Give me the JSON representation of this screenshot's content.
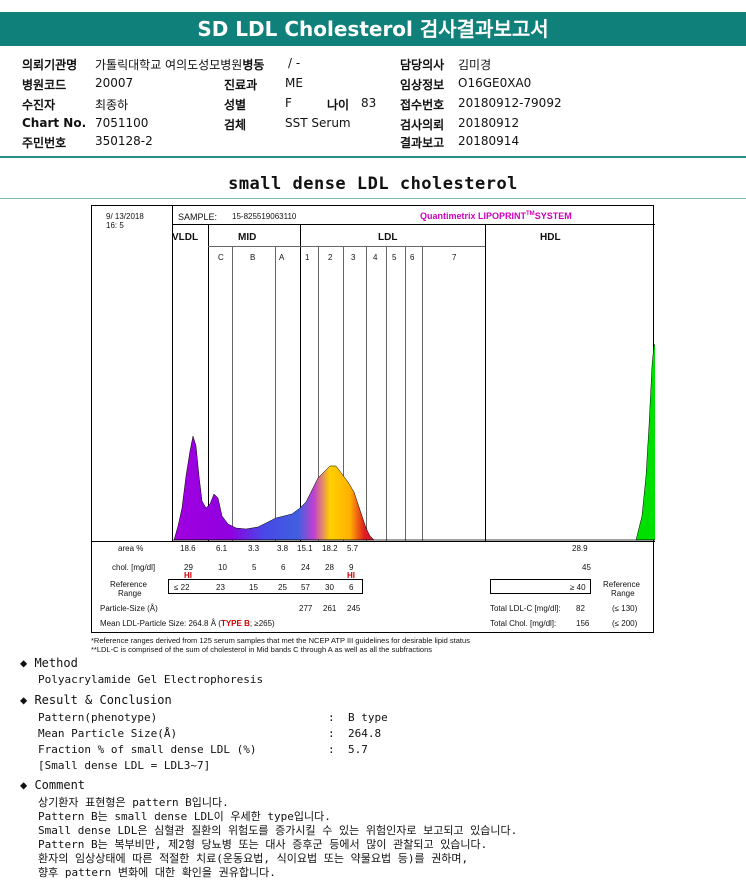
{
  "title": "SD LDL Cholesterol 검사결과보고서",
  "info": {
    "institution_label": "의뢰기관명",
    "institution_value": "가톨릭대학교 여의도성모병원",
    "ward_label": "병동",
    "ward_value": "/ -",
    "doctor_label": "담당의사",
    "doctor_value": "김미경",
    "hospital_code_label": "병원코드",
    "hospital_code_value": "20007",
    "department_label": "진료과",
    "department_value": "ME",
    "clinical_info_label": "임상정보",
    "clinical_info_value": "O16GE0XA0",
    "patient_label": "수진자",
    "patient_value": "최종하",
    "sex_label": "성별",
    "sex_value": "F",
    "age_label": "나이",
    "age_value": "83",
    "receipt_no_label": "접수번호",
    "receipt_no_value": "20180912-79092",
    "chart_no_label": "Chart No.",
    "chart_no_value": "7051100",
    "specimen_label": "검체",
    "specimen_value": "SST Serum",
    "request_date_label": "검사의뢰",
    "request_date_value": "20180912",
    "resident_no_label": "주민번호",
    "resident_no_value": "350128-2",
    "report_date_label": "결과보고",
    "report_date_value": "20180914"
  },
  "section_title": "small dense LDL cholesterol",
  "report": {
    "date": "9/ 13/2018",
    "time": "16: 5",
    "sample_label": "SAMPLE:",
    "sample_value": "15-825519063110",
    "system_name": "Quantimetrix LIPOPRINT",
    "system_tm": "TM",
    "system_suffix": "SYSTEM",
    "group_vldl": "VLDL",
    "group_mid": "MID",
    "group_ldl": "LDL",
    "group_hdl": "HDL",
    "bands": [
      "C",
      "B",
      "A",
      "1",
      "2",
      "3",
      "4",
      "5",
      "6",
      "7"
    ],
    "area_label": "area %",
    "area_values": [
      "18.6",
      "6.1",
      "3.3",
      "3.8",
      "15.1",
      "18.2",
      "5.7"
    ],
    "area_hdl": "28.9",
    "chol_label": "chol. [mg/dl]",
    "chol_values": [
      "29",
      "10",
      "5",
      "6",
      "24",
      "28",
      "9"
    ],
    "chol_hdl": "45",
    "hi_flag": "HI",
    "ref_label_1": "Reference",
    "ref_label_2": "Range",
    "ref_values": [
      "≤ 22",
      "23",
      "15",
      "25",
      "57",
      "30",
      "6"
    ],
    "ref_hdl": "≥ 40",
    "particle_label": "Particle-Size (Å)",
    "particle_values": [
      "277",
      "261",
      "245"
    ],
    "mean_size_text": "Mean LDL-Particle Size:    264.8 Å  (",
    "type_b": "TYPE B",
    "mean_size_suffix": "; ≥265)",
    "total_ldl_label": "Total LDL-C [mg/dl]:",
    "total_ldl_value": "82",
    "total_ldl_ref": "(≤ 130)",
    "total_chol_label": "Total Chol. [mg/dl]:",
    "total_chol_value": "156",
    "total_chol_ref": "(≤ 200)"
  },
  "footnotes": [
    "*Reference ranges derived from 125 serum samples that met the NCEP ATP III guidelines for desirable lipid status",
    "**LDL-C is comprised of the sum of cholesterol in Mid bands C through A as well as all the subfractions"
  ],
  "method_heading": "◆ Method",
  "method_text": "Polyacrylamide Gel Electrophoresis",
  "result_heading": "◆ Result & Conclusion",
  "results": [
    {
      "label": "Pattern(phenotype)",
      "colon": ":",
      "value": "B type"
    },
    {
      "label": "Mean Particle Size(Å)",
      "colon": ":",
      "value": "264.8"
    },
    {
      "label": "Fraction % of small dense LDL (%)",
      "colon": ":",
      "value": "5.7"
    }
  ],
  "small_dense_note": "[Small dense LDL = LDL3~7]",
  "comment_heading": "◆ Comment",
  "comments": [
    "상기환자 표현형은 pattern B입니다.",
    "Pattern B는 small dense LDL이 우세한 type입니다.",
    "Small dense LDL은 심혈관 질환의 위험도를 증가시킬 수 있는 위험인자로 보고되고 있습니다.",
    "Pattern B는 복부비만, 제2형 당뇨병 또는 대사 증후군 등에서 많이 관찰되고 있습니다.",
    "환자의 임상상태에 따른 적절한 치료(운동요법, 식이요법 또는 약물요법 등)를 권하며,",
    "향후 pattern 변화에 대한 확인을 권유합니다."
  ],
  "colors": {
    "header": "#10807a",
    "vldl": "#a000e0",
    "mid": "#4040e0",
    "ldl": "#ffc000",
    "hdl": "#00d000",
    "flag": "#d00000"
  }
}
